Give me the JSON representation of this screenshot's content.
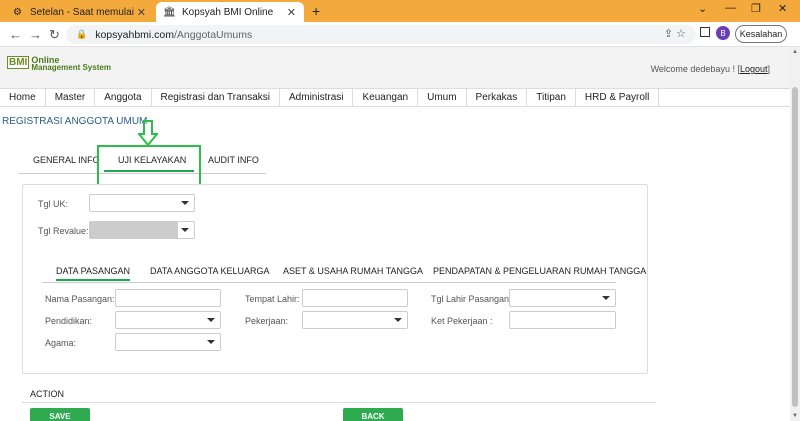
{
  "browser": {
    "tabs": [
      {
        "title": "Setelan - Saat memulai",
        "icon": "gear-icon"
      },
      {
        "title": "Kopsyah BMI Online",
        "icon": "site-favicon"
      }
    ],
    "url_domain": "kopsyahbmi.com",
    "url_path": "/AnggotaUmums",
    "profile_initial": "B",
    "profile_status": "Kesalahan"
  },
  "app": {
    "logo_mark": "BMI",
    "logo_line1": "Online",
    "logo_line2": "Management System",
    "welcome_text": "Welcome dedebayu ! [",
    "logout_label": "Logout",
    "welcome_close": "]",
    "nav": [
      "Home",
      "Master",
      "Anggota",
      "Registrasi dan Transaksi",
      "Administrasi",
      "Keuangan",
      "Umum",
      "Perkakas",
      "Titipan",
      "HRD & Payroll"
    ],
    "page_title": "REGISTRASI ANGGOTA UMUM"
  },
  "top_tabs": [
    "GENERAL INFO",
    "UJI KELAYAKAN",
    "AUDIT INFO"
  ],
  "uk": {
    "tgl_uk_label": "Tgl UK:",
    "tgl_revalue_label": "Tgl Revalue:"
  },
  "sub_tabs": [
    "DATA PASANGAN",
    "DATA ANGGOTA KELUARGA",
    "ASET & USAHA RUMAH TANGGA",
    "PENDAPATAN & PENGELUARAN RUMAH TANGGA"
  ],
  "fields": {
    "nama_pasangan": "Nama Pasangan:",
    "tempat_lahir": "Tempat Lahir:",
    "tgl_lahir_pasangan": "Tgl Lahir Pasangan:",
    "pendidikan": "Pendidikan:",
    "pekerjaan": "Pekerjaan:",
    "ket_pekerjaan": "Ket Pekerjaan :",
    "agama": "Agama:"
  },
  "action": {
    "label": "ACTION",
    "save": "SAVE",
    "back": "BACK"
  },
  "colors": {
    "accent_green": "#2eaa4f",
    "tabstrip": "#f4a93c",
    "title_blue": "#2a5d8a"
  }
}
